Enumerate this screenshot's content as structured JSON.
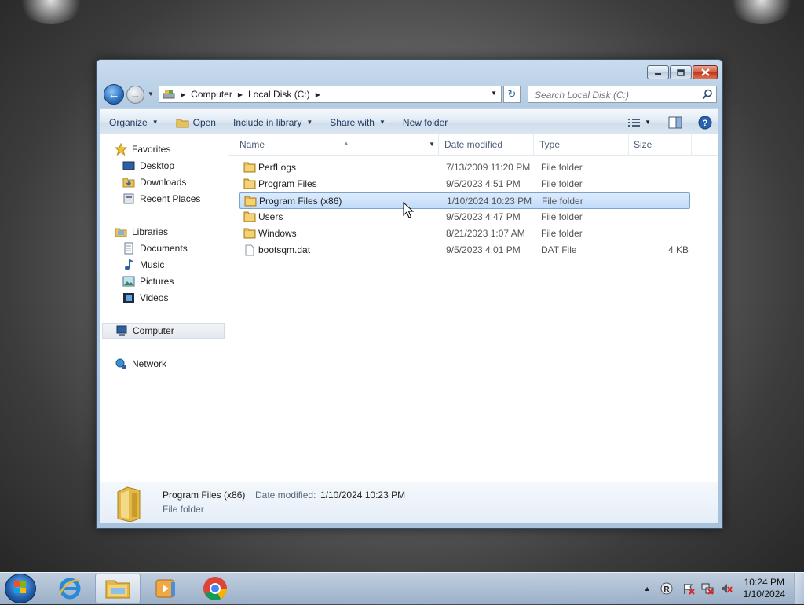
{
  "window": {
    "caption_buttons": [
      "minimize-icon",
      "maximize-icon",
      "close-icon"
    ]
  },
  "navigation": {
    "back_icon": "back-arrow-icon",
    "forward_icon": "forward-arrow-icon",
    "breadcrumb": [
      "Computer",
      "Local Disk (C:)"
    ],
    "search_placeholder": "Search Local Disk (C:)"
  },
  "toolbar": {
    "organize": "Organize",
    "open": "Open",
    "include_in_library": "Include in library",
    "share_with": "Share with",
    "new_folder": "New folder"
  },
  "nav_pane": {
    "favorites": "Favorites",
    "desktop": "Desktop",
    "downloads": "Downloads",
    "recent_places": "Recent Places",
    "libraries": "Libraries",
    "documents": "Documents",
    "music": "Music",
    "pictures": "Pictures",
    "videos": "Videos",
    "computer": "Computer",
    "network": "Network"
  },
  "columns": {
    "name": "Name",
    "date_modified": "Date modified",
    "type": "Type",
    "size": "Size"
  },
  "files": [
    {
      "name": "PerfLogs",
      "date": "7/13/2009 11:20 PM",
      "type": "File folder",
      "size": "",
      "icon": "folder-icon"
    },
    {
      "name": "Program Files",
      "date": "9/5/2023 4:51 PM",
      "type": "File folder",
      "size": "",
      "icon": "folder-icon"
    },
    {
      "name": "Program Files (x86)",
      "date": "1/10/2024 10:23 PM",
      "type": "File folder",
      "size": "",
      "icon": "folder-icon",
      "selected": true
    },
    {
      "name": "Users",
      "date": "9/5/2023 4:47 PM",
      "type": "File folder",
      "size": "",
      "icon": "folder-icon"
    },
    {
      "name": "Windows",
      "date": "8/21/2023 1:07 AM",
      "type": "File folder",
      "size": "",
      "icon": "folder-icon"
    },
    {
      "name": "bootsqm.dat",
      "date": "9/5/2023 4:01 PM",
      "type": "DAT File",
      "size": "4 KB",
      "icon": "file-icon"
    }
  ],
  "details": {
    "name": "Program Files (x86)",
    "date_label": "Date modified:",
    "date_value": "1/10/2024 10:23 PM",
    "type": "File folder"
  },
  "taskbar": {
    "time": "10:24 PM",
    "date": "1/10/2024",
    "apps": [
      "internet-explorer-icon",
      "windows-explorer-icon",
      "media-player-icon",
      "chrome-icon"
    ]
  },
  "colors": {
    "selection": "#c9e0fb",
    "accent": "#1e395b"
  }
}
